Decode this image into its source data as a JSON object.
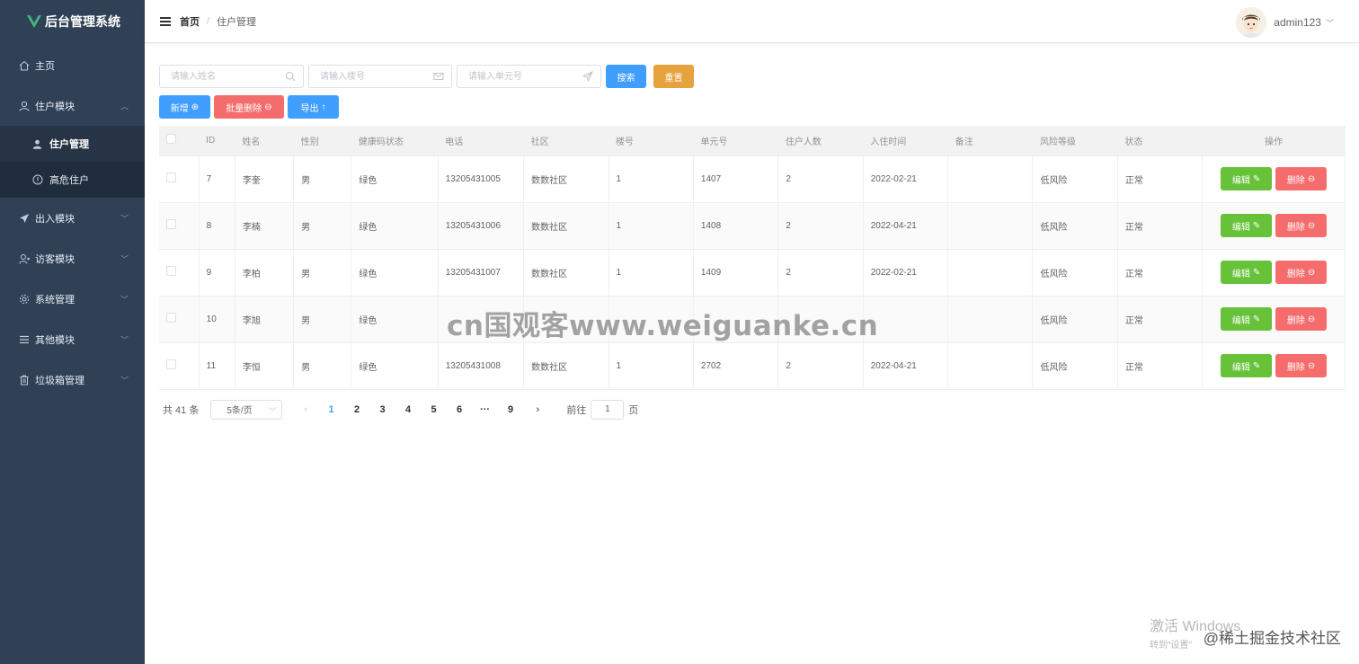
{
  "app": {
    "title": "后台管理系统",
    "logo_color": "#41b883"
  },
  "sidebar": {
    "items": [
      {
        "label": "主页",
        "icon": "home-icon"
      },
      {
        "label": "住户模块",
        "icon": "user-icon",
        "expanded": true,
        "children": [
          {
            "label": "住户管理",
            "icon": "person-icon",
            "active": true
          },
          {
            "label": "高危住户",
            "icon": "warning-circle-icon"
          }
        ]
      },
      {
        "label": "出入模块",
        "icon": "paper-plane-icon"
      },
      {
        "label": "访客模块",
        "icon": "visitor-icon"
      },
      {
        "label": "系统管理",
        "icon": "gear-icon"
      },
      {
        "label": "其他模块",
        "icon": "list-icon"
      },
      {
        "label": "垃圾箱管理",
        "icon": "trash-icon"
      }
    ]
  },
  "header": {
    "breadcrumb": {
      "home": "首页",
      "separator": "/",
      "current": "住户管理"
    },
    "username": "admin123"
  },
  "search": {
    "name_placeholder": "请输入姓名",
    "building_placeholder": "请输入楼号",
    "unit_placeholder": "请输入单元号",
    "search_label": "搜索",
    "reset_label": "重置"
  },
  "toolbar": {
    "add_label": "新增",
    "batch_delete_label": "批量删除",
    "export_label": "导出"
  },
  "table": {
    "columns": [
      "ID",
      "姓名",
      "性别",
      "健康码状态",
      "电话",
      "社区",
      "楼号",
      "单元号",
      "住户人数",
      "入住时间",
      "备注",
      "风险等级",
      "状态",
      "操作"
    ],
    "edit_label": "编辑",
    "delete_label": "删除",
    "rows": [
      {
        "id": "7",
        "name": "李奎",
        "gender": "男",
        "health": "绿色",
        "phone": "13205431005",
        "community": "数数社区",
        "building": "1",
        "unit": "1407",
        "residents": "2",
        "checkin": "2022-02-21",
        "note": "",
        "risk": "低风险",
        "status": "正常"
      },
      {
        "id": "8",
        "name": "李楠",
        "gender": "男",
        "health": "绿色",
        "phone": "13205431006",
        "community": "数数社区",
        "building": "1",
        "unit": "1408",
        "residents": "2",
        "checkin": "2022-04-21",
        "note": "",
        "risk": "低风险",
        "status": "正常"
      },
      {
        "id": "9",
        "name": "李柏",
        "gender": "男",
        "health": "绿色",
        "phone": "13205431007",
        "community": "数数社区",
        "building": "1",
        "unit": "1409",
        "residents": "2",
        "checkin": "2022-02-21",
        "note": "",
        "risk": "低风险",
        "status": "正常"
      },
      {
        "id": "10",
        "name": "李旭",
        "gender": "男",
        "health": "绿色",
        "phone": "",
        "community": "",
        "building": "",
        "unit": "",
        "residents": "",
        "checkin": "",
        "note": "",
        "risk": "低风险",
        "status": "正常"
      },
      {
        "id": "11",
        "name": "李恒",
        "gender": "男",
        "health": "绿色",
        "phone": "13205431008",
        "community": "数数社区",
        "building": "1",
        "unit": "2702",
        "residents": "2",
        "checkin": "2022-04-21",
        "note": "",
        "risk": "低风险",
        "status": "正常"
      }
    ]
  },
  "pagination": {
    "total": "共 41 条",
    "page_size": "5条/页",
    "pages": [
      "1",
      "2",
      "3",
      "4",
      "5",
      "6",
      "···",
      "9"
    ],
    "current": "1",
    "goto_prefix": "前往",
    "goto_value": "1",
    "goto_suffix": "页"
  },
  "overlays": {
    "watermark": "cn国观客www.weiguanke.cn",
    "windows_activate": "激活 Windows",
    "windows_activate_sub": "转到\"设置\"",
    "juejin": "@稀土掘金技术社区"
  },
  "colors": {
    "sidebar_bg": "#304156",
    "primary": "#409eff",
    "warning": "#e6a23c",
    "danger": "#f56c6c",
    "success": "#67c23a"
  }
}
